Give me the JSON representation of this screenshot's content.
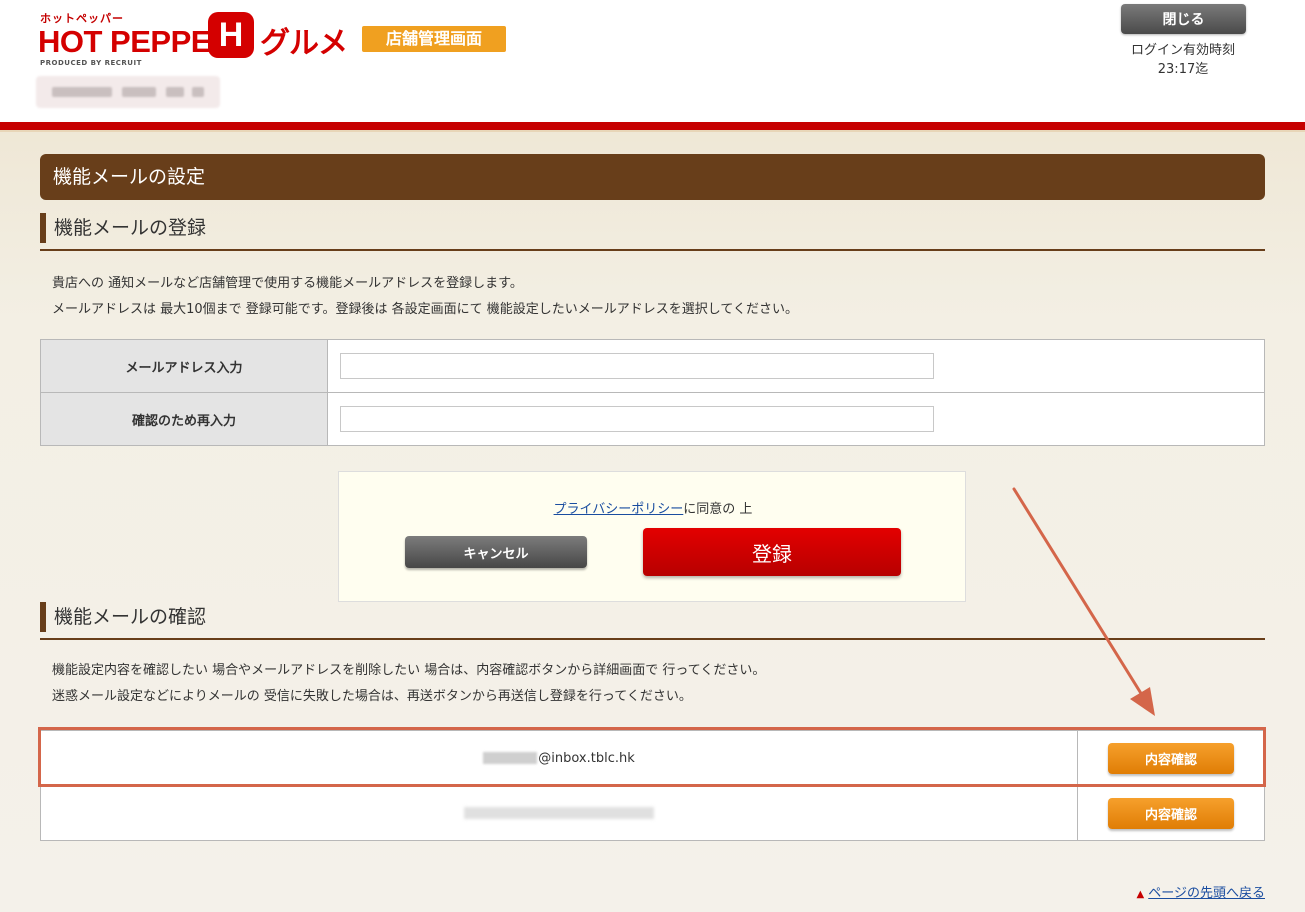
{
  "header": {
    "brand_kana": "ホットペッパー",
    "brand_main": "HOT PEPPER",
    "brand_letter": "H",
    "brand_gourmet": "グルメ",
    "brand_badge": "店舗管理画面",
    "brand_produced": "PRODUCED BY RECRUIT",
    "close_label": "閉じる",
    "login_label": "ログイン有効時刻",
    "login_time": "23:17迄"
  },
  "page_title": "機能メールの設定",
  "register_section": {
    "title": "機能メールの登録",
    "desc_line1": "貴店への 通知メールなど店舗管理で使用する機能メールアドレスを登録します。",
    "desc_line2": "メールアドレスは 最大10個まで 登録可能です。登録後は 各設定画面にて 機能設定したいメールアドレスを選択してください。",
    "email_label": "メールアドレス入力",
    "email_value": "",
    "confirm_label": "確認のため再入力",
    "confirm_value": "",
    "privacy_link": "プライバシーポリシー",
    "privacy_suffix": "に同意の 上",
    "cancel_label": "キャンセル",
    "register_label": "登録"
  },
  "confirm_section": {
    "title": "機能メールの確認",
    "desc_line1": "機能設定内容を確認したい 場合やメールアドレスを削除したい 場合は、内容確認ボタンから詳細画面で 行ってください。",
    "desc_line2": "迷惑メール設定などによりメールの 受信に失敗した場合は、再送ボタンから再送信し登録を行ってください。",
    "rows": [
      {
        "address": "@inbox.tblc.hk",
        "button": "内容確認"
      },
      {
        "address": "",
        "button": "内容確認"
      }
    ]
  },
  "back_to_top": "ページの先頭へ戻る",
  "colors": {
    "brand_red": "#d40000",
    "header_bar": "#c60000",
    "section_brown": "#683e1a",
    "badge_orange": "#f0a020",
    "confirm_orange": "#e88a10",
    "annotation": "#d4664a"
  }
}
